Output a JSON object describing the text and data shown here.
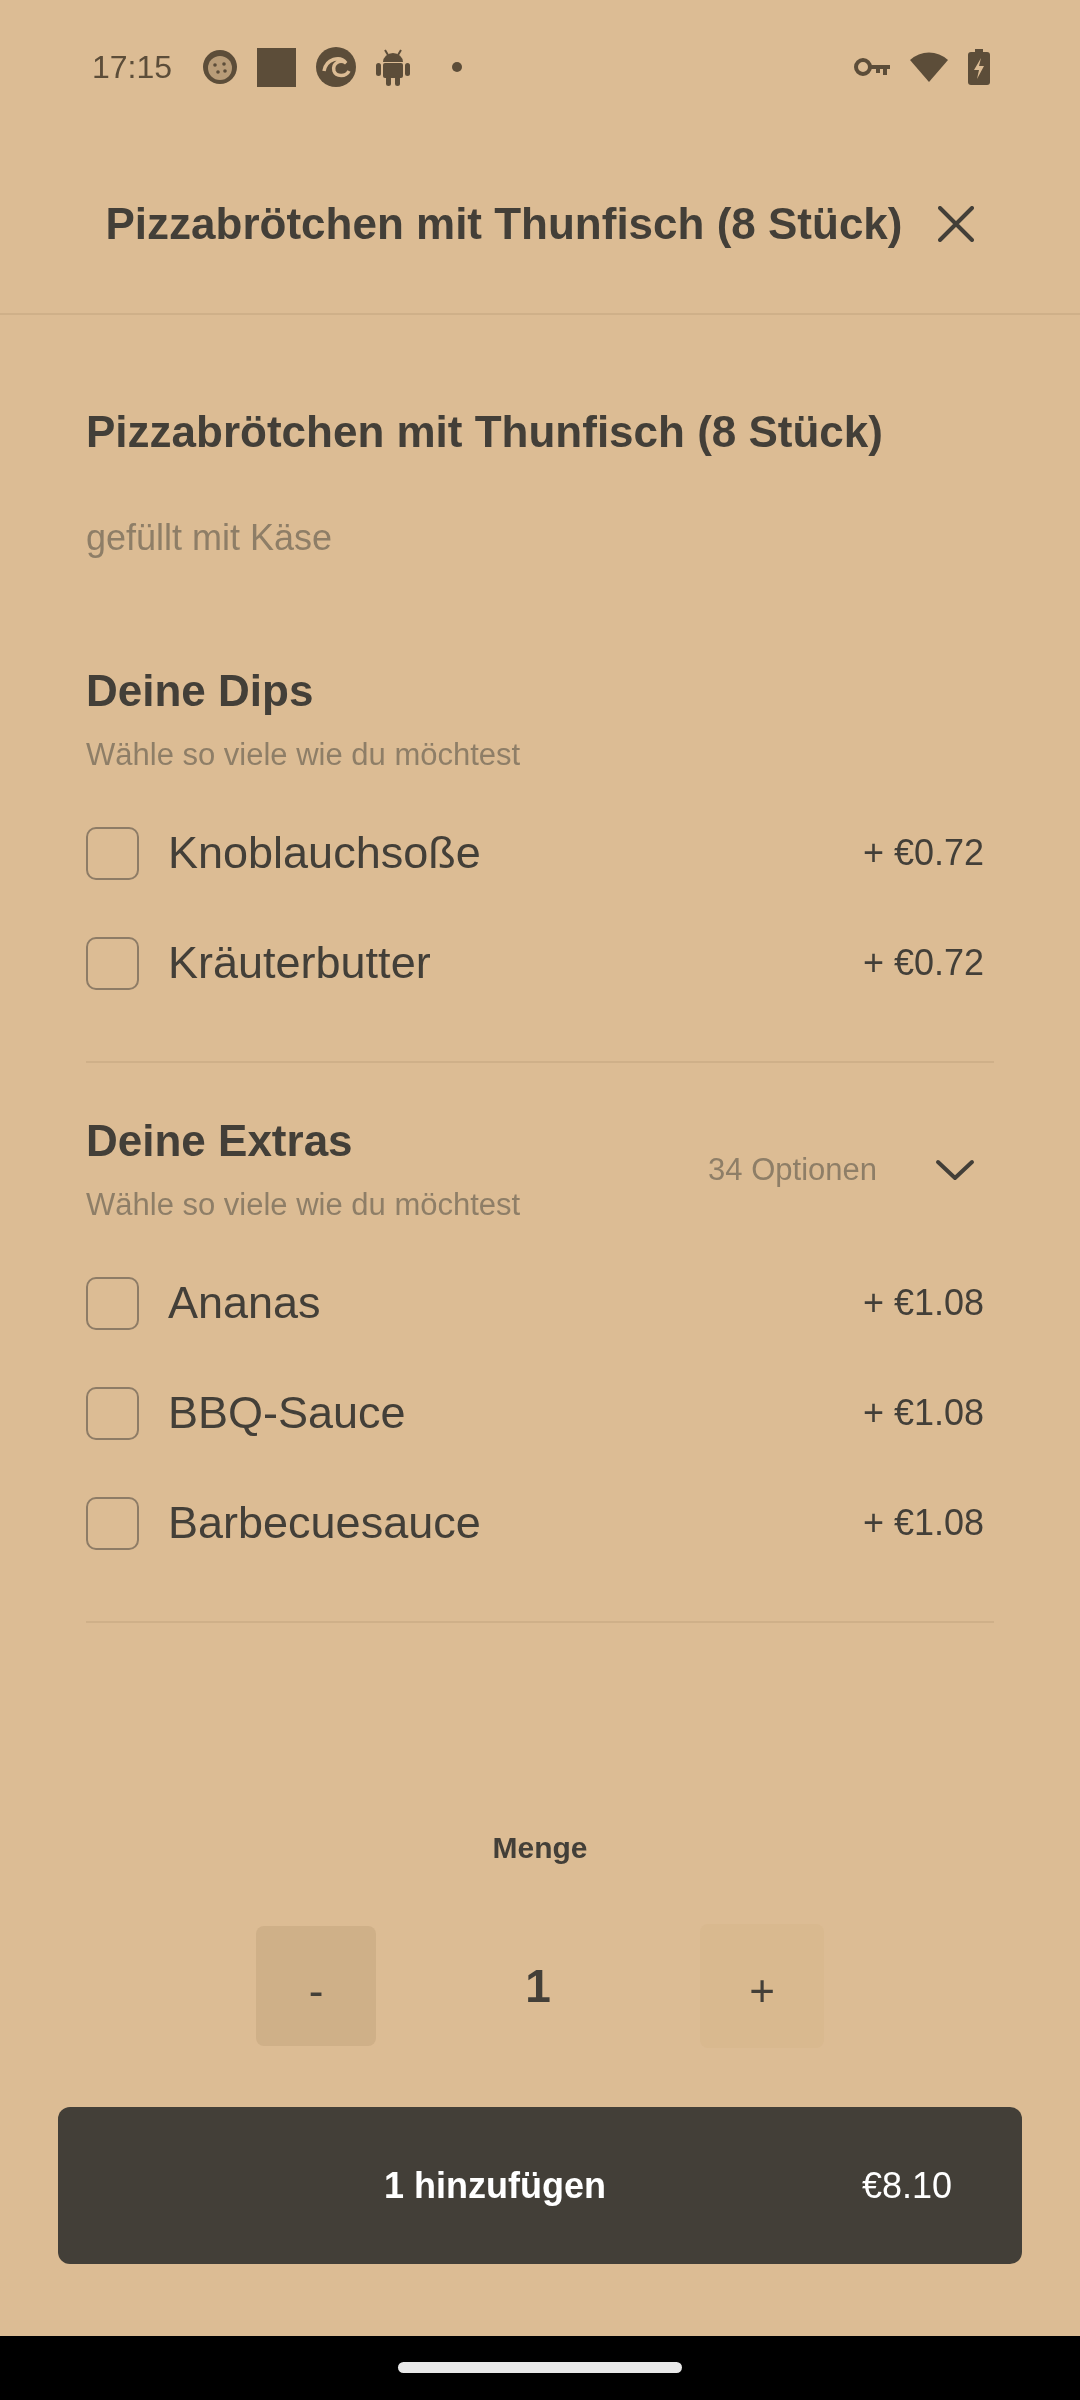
{
  "status_bar": {
    "time": "17:15"
  },
  "header": {
    "title": "Pizzabrötchen mit Thunfisch (8 Stück)"
  },
  "product": {
    "name": "Pizzabrötchen mit Thunfisch (8 Stück)",
    "description": "gefüllt mit Käse"
  },
  "option_groups": [
    {
      "title": "Deine Dips",
      "hint": "Wähle so viele wie du möchtest",
      "items": [
        {
          "label": "Knoblauchsoße",
          "price": "+ €0.72",
          "checked": false
        },
        {
          "label": "Kräuterbutter",
          "price": "+ €0.72",
          "checked": false
        }
      ]
    },
    {
      "title": "Deine Extras",
      "hint": "Wähle so viele wie du möchtest",
      "count": "34 Optionen",
      "expanded": false,
      "items": [
        {
          "label": "Ananas",
          "price": "+ €1.08",
          "checked": false
        },
        {
          "label": "BBQ-Sauce",
          "price": "+ €1.08",
          "checked": false
        },
        {
          "label": "Barbecuesauce",
          "price": "+ €1.08",
          "checked": false
        }
      ]
    }
  ],
  "quantity": {
    "label": "Menge",
    "decrement": "-",
    "value": "1",
    "increment": "+"
  },
  "add_button": {
    "label": "1 hinzufügen",
    "price": "€8.10"
  }
}
